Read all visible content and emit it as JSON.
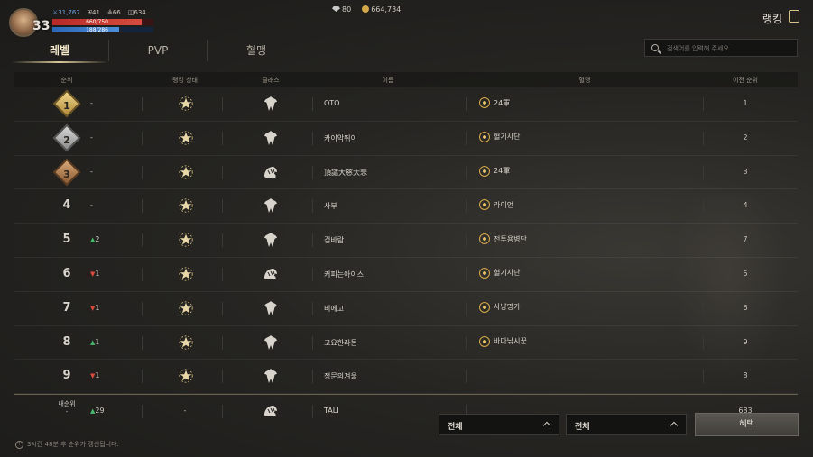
{
  "hud": {
    "level": "33",
    "power": "31,767",
    "stat2": "41",
    "stat3": "66",
    "stat4": "634",
    "hp_text": "660/750",
    "hp_fraction": 0.88,
    "mp_text": "188/286",
    "mp_fraction": 0.66,
    "gems": "80",
    "gold": "664,734"
  },
  "page_title": "랭킹",
  "tabs": [
    {
      "label": "레벨",
      "active": true
    },
    {
      "label": "PVP",
      "active": false
    },
    {
      "label": "혈맹",
      "active": false
    }
  ],
  "search": {
    "placeholder": "검색어를 입력해 주세요."
  },
  "table": {
    "headers": {
      "rank": "순위",
      "state": "랭킹 상태",
      "class": "클래스",
      "name": "이름",
      "guild": "혈맹",
      "prev": "이전 순위"
    },
    "rows": [
      {
        "rank": "1",
        "badge": "gold",
        "change": "-",
        "dir": "none",
        "class_icon": "claw-class-icon",
        "name": "OTO",
        "guild": "24軍",
        "prev": "1"
      },
      {
        "rank": "2",
        "badge": "silver",
        "change": "-",
        "dir": "none",
        "class_icon": "claw-class-icon",
        "name": "카이악뛰이",
        "guild": "혈기사단",
        "prev": "2"
      },
      {
        "rank": "3",
        "badge": "bronze",
        "change": "-",
        "dir": "none",
        "class_icon": "beast-class-icon",
        "name": "頂譴大慈大悲",
        "guild": "24軍",
        "prev": "3"
      },
      {
        "rank": "4",
        "badge": "",
        "change": "-",
        "dir": "none",
        "class_icon": "claw-class-icon",
        "name": "사부",
        "guild": "라이언",
        "prev": "4"
      },
      {
        "rank": "5",
        "badge": "",
        "change": "2",
        "dir": "up",
        "class_icon": "claw-class-icon",
        "name": "검바람",
        "guild": "전투용병단",
        "prev": "7"
      },
      {
        "rank": "6",
        "badge": "",
        "change": "1",
        "dir": "down",
        "class_icon": "beast-class-icon",
        "name": "커피는아이스",
        "guild": "혈기사단",
        "prev": "5"
      },
      {
        "rank": "7",
        "badge": "",
        "change": "1",
        "dir": "down",
        "class_icon": "claw-class-icon",
        "name": "비에고",
        "guild": "사냥명가",
        "prev": "6"
      },
      {
        "rank": "8",
        "badge": "",
        "change": "1",
        "dir": "up",
        "class_icon": "claw-class-icon",
        "name": "고요한라톤",
        "guild": "바다낚시꾼",
        "prev": "9"
      },
      {
        "rank": "9",
        "badge": "",
        "change": "1",
        "dir": "down",
        "class_icon": "claw-class-icon",
        "name": "정문의겨울",
        "guild": "",
        "prev": "8"
      }
    ],
    "my_row": {
      "label": "내순위",
      "label2": "-",
      "change": "29",
      "dir": "up",
      "state": "-",
      "class_icon": "beast-class-icon",
      "name": "TALI",
      "prev": "683"
    }
  },
  "filters": [
    {
      "value": "전체"
    },
    {
      "value": "전체"
    }
  ],
  "benefit_label": "혜택",
  "notice": "3시간 48분 후 순위가 갱신됩니다.",
  "colors": {
    "accent": "#d8c89a",
    "up": "#4ab86a",
    "down": "#d84a3a",
    "gold": "#d4a84a"
  }
}
